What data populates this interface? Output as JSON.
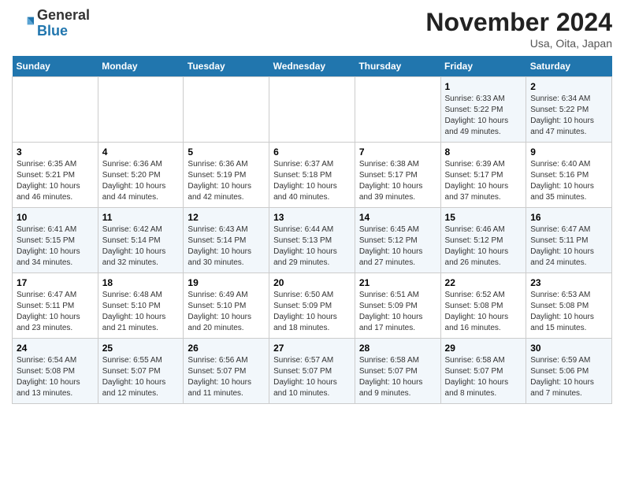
{
  "header": {
    "logo_general": "General",
    "logo_blue": "Blue",
    "title": "November 2024",
    "subtitle": "Usa, Oita, Japan"
  },
  "weekdays": [
    "Sunday",
    "Monday",
    "Tuesday",
    "Wednesday",
    "Thursday",
    "Friday",
    "Saturday"
  ],
  "weeks": [
    [
      {
        "day": "",
        "detail": ""
      },
      {
        "day": "",
        "detail": ""
      },
      {
        "day": "",
        "detail": ""
      },
      {
        "day": "",
        "detail": ""
      },
      {
        "day": "",
        "detail": ""
      },
      {
        "day": "1",
        "detail": "Sunrise: 6:33 AM\nSunset: 5:22 PM\nDaylight: 10 hours\nand 49 minutes."
      },
      {
        "day": "2",
        "detail": "Sunrise: 6:34 AM\nSunset: 5:22 PM\nDaylight: 10 hours\nand 47 minutes."
      }
    ],
    [
      {
        "day": "3",
        "detail": "Sunrise: 6:35 AM\nSunset: 5:21 PM\nDaylight: 10 hours\nand 46 minutes."
      },
      {
        "day": "4",
        "detail": "Sunrise: 6:36 AM\nSunset: 5:20 PM\nDaylight: 10 hours\nand 44 minutes."
      },
      {
        "day": "5",
        "detail": "Sunrise: 6:36 AM\nSunset: 5:19 PM\nDaylight: 10 hours\nand 42 minutes."
      },
      {
        "day": "6",
        "detail": "Sunrise: 6:37 AM\nSunset: 5:18 PM\nDaylight: 10 hours\nand 40 minutes."
      },
      {
        "day": "7",
        "detail": "Sunrise: 6:38 AM\nSunset: 5:17 PM\nDaylight: 10 hours\nand 39 minutes."
      },
      {
        "day": "8",
        "detail": "Sunrise: 6:39 AM\nSunset: 5:17 PM\nDaylight: 10 hours\nand 37 minutes."
      },
      {
        "day": "9",
        "detail": "Sunrise: 6:40 AM\nSunset: 5:16 PM\nDaylight: 10 hours\nand 35 minutes."
      }
    ],
    [
      {
        "day": "10",
        "detail": "Sunrise: 6:41 AM\nSunset: 5:15 PM\nDaylight: 10 hours\nand 34 minutes."
      },
      {
        "day": "11",
        "detail": "Sunrise: 6:42 AM\nSunset: 5:14 PM\nDaylight: 10 hours\nand 32 minutes."
      },
      {
        "day": "12",
        "detail": "Sunrise: 6:43 AM\nSunset: 5:14 PM\nDaylight: 10 hours\nand 30 minutes."
      },
      {
        "day": "13",
        "detail": "Sunrise: 6:44 AM\nSunset: 5:13 PM\nDaylight: 10 hours\nand 29 minutes."
      },
      {
        "day": "14",
        "detail": "Sunrise: 6:45 AM\nSunset: 5:12 PM\nDaylight: 10 hours\nand 27 minutes."
      },
      {
        "day": "15",
        "detail": "Sunrise: 6:46 AM\nSunset: 5:12 PM\nDaylight: 10 hours\nand 26 minutes."
      },
      {
        "day": "16",
        "detail": "Sunrise: 6:47 AM\nSunset: 5:11 PM\nDaylight: 10 hours\nand 24 minutes."
      }
    ],
    [
      {
        "day": "17",
        "detail": "Sunrise: 6:47 AM\nSunset: 5:11 PM\nDaylight: 10 hours\nand 23 minutes."
      },
      {
        "day": "18",
        "detail": "Sunrise: 6:48 AM\nSunset: 5:10 PM\nDaylight: 10 hours\nand 21 minutes."
      },
      {
        "day": "19",
        "detail": "Sunrise: 6:49 AM\nSunset: 5:10 PM\nDaylight: 10 hours\nand 20 minutes."
      },
      {
        "day": "20",
        "detail": "Sunrise: 6:50 AM\nSunset: 5:09 PM\nDaylight: 10 hours\nand 18 minutes."
      },
      {
        "day": "21",
        "detail": "Sunrise: 6:51 AM\nSunset: 5:09 PM\nDaylight: 10 hours\nand 17 minutes."
      },
      {
        "day": "22",
        "detail": "Sunrise: 6:52 AM\nSunset: 5:08 PM\nDaylight: 10 hours\nand 16 minutes."
      },
      {
        "day": "23",
        "detail": "Sunrise: 6:53 AM\nSunset: 5:08 PM\nDaylight: 10 hours\nand 15 minutes."
      }
    ],
    [
      {
        "day": "24",
        "detail": "Sunrise: 6:54 AM\nSunset: 5:08 PM\nDaylight: 10 hours\nand 13 minutes."
      },
      {
        "day": "25",
        "detail": "Sunrise: 6:55 AM\nSunset: 5:07 PM\nDaylight: 10 hours\nand 12 minutes."
      },
      {
        "day": "26",
        "detail": "Sunrise: 6:56 AM\nSunset: 5:07 PM\nDaylight: 10 hours\nand 11 minutes."
      },
      {
        "day": "27",
        "detail": "Sunrise: 6:57 AM\nSunset: 5:07 PM\nDaylight: 10 hours\nand 10 minutes."
      },
      {
        "day": "28",
        "detail": "Sunrise: 6:58 AM\nSunset: 5:07 PM\nDaylight: 10 hours\nand 9 minutes."
      },
      {
        "day": "29",
        "detail": "Sunrise: 6:58 AM\nSunset: 5:07 PM\nDaylight: 10 hours\nand 8 minutes."
      },
      {
        "day": "30",
        "detail": "Sunrise: 6:59 AM\nSunset: 5:06 PM\nDaylight: 10 hours\nand 7 minutes."
      }
    ]
  ]
}
